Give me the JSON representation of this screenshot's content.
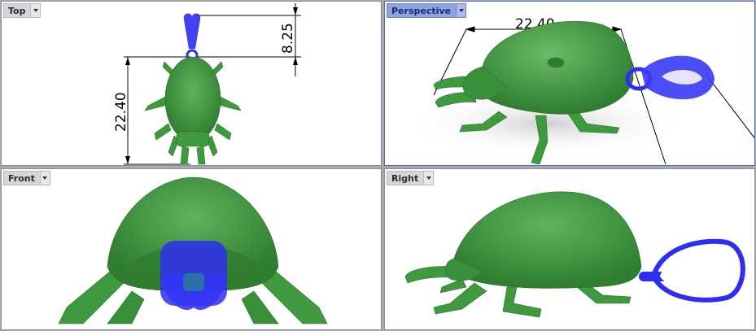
{
  "viewports": {
    "top": {
      "label": "Top",
      "dim_height": "22.40",
      "dim_bail": "8.25"
    },
    "perspective": {
      "label": "Perspective",
      "dim_length": "22.40"
    },
    "front": {
      "label": "Front"
    },
    "right": {
      "label": "Right"
    }
  },
  "icons": {
    "viewport_menu": "chevron-down-icon"
  },
  "colors": {
    "body_green": "#3f9a3f",
    "bail_blue": "#2e2ef0",
    "active_viewport": "#8da3e4",
    "viewport_label": "#d4d6da"
  }
}
